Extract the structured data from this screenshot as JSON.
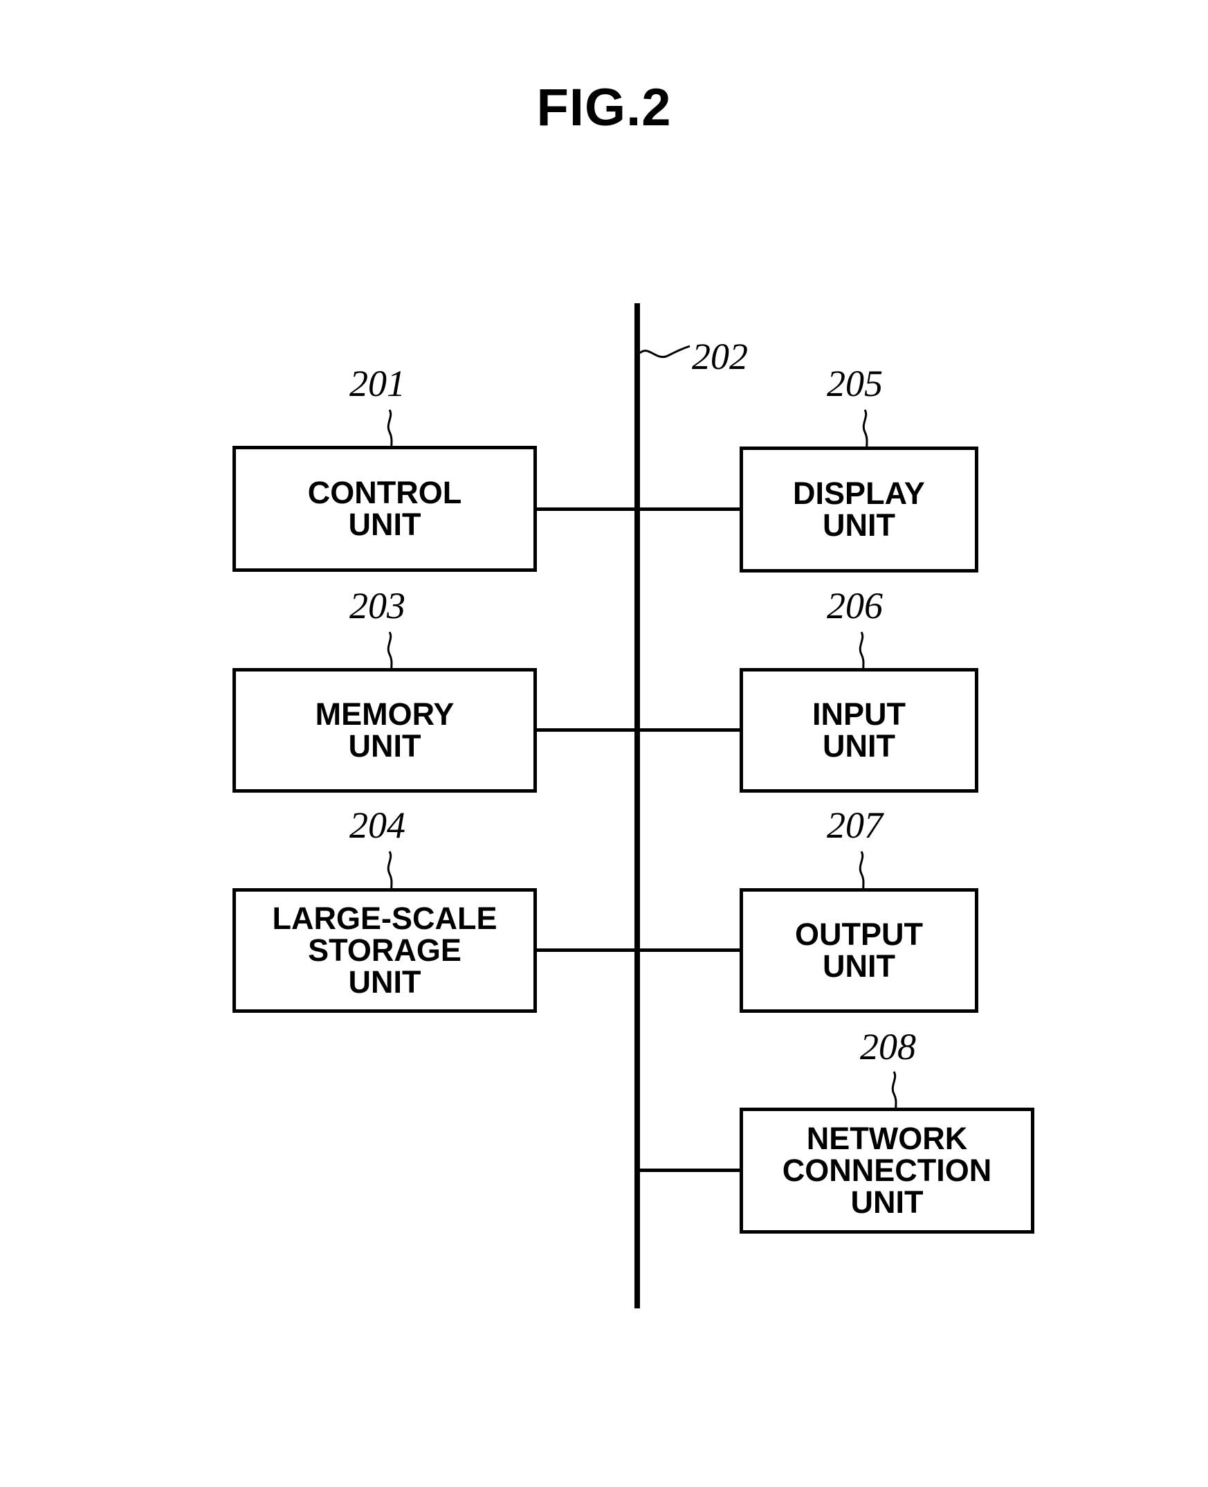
{
  "figure": {
    "title": "FIG.2"
  },
  "bus": {
    "ref": "202",
    "name": "system-bus"
  },
  "units": [
    {
      "ref": "201",
      "label": "CONTROL\nUNIT",
      "name": "control-unit",
      "column": "left"
    },
    {
      "ref": "203",
      "label": "MEMORY\nUNIT",
      "name": "memory-unit",
      "column": "left"
    },
    {
      "ref": "204",
      "label": "LARGE-SCALE\nSTORAGE\nUNIT",
      "name": "large-scale-storage-unit",
      "column": "left"
    },
    {
      "ref": "205",
      "label": "DISPLAY\nUNIT",
      "name": "display-unit",
      "column": "right"
    },
    {
      "ref": "206",
      "label": "INPUT\nUNIT",
      "name": "input-unit",
      "column": "right"
    },
    {
      "ref": "207",
      "label": "OUTPUT\nUNIT",
      "name": "output-unit",
      "column": "right"
    },
    {
      "ref": "208",
      "label": "NETWORK\nCONNECTION\nUNIT",
      "name": "network-connection-unit",
      "column": "right"
    }
  ],
  "colors": {
    "ink": "#000000",
    "paper": "#ffffff"
  }
}
